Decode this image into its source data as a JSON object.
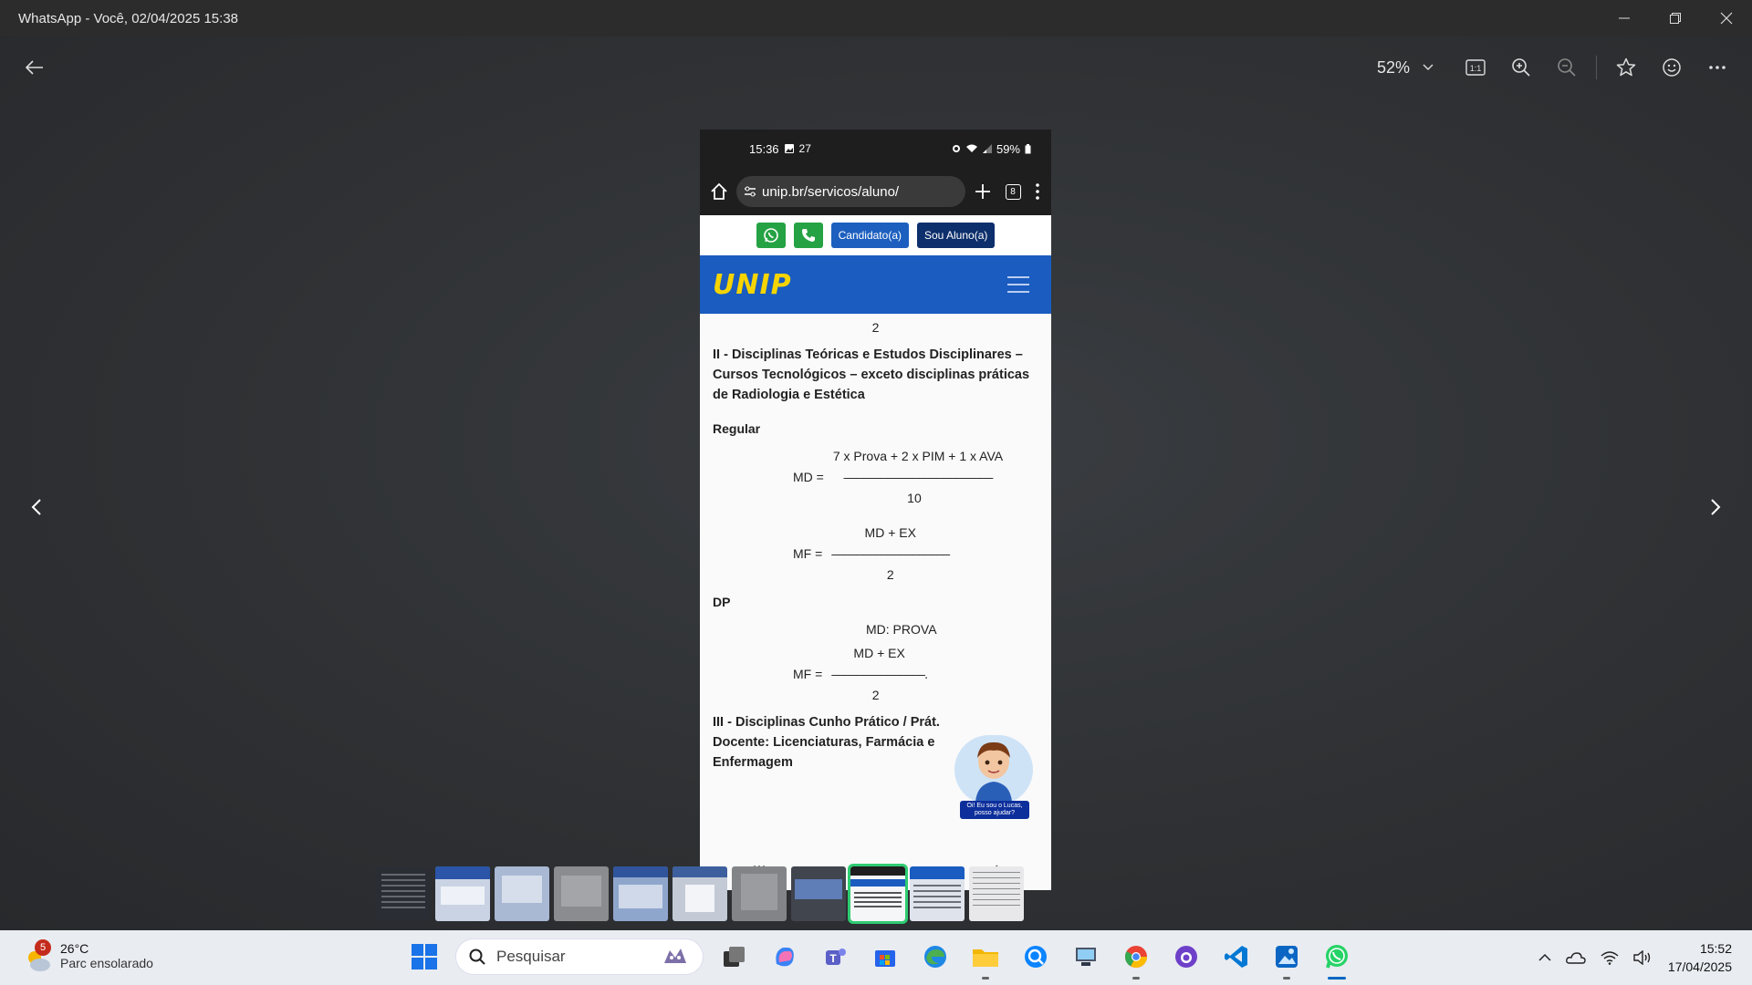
{
  "window": {
    "title": "WhatsApp - Você, 02/04/2025 15:38",
    "minimize_icon": "minimize-icon",
    "maximize_icon": "restore-icon",
    "close_icon": "close-icon"
  },
  "viewer": {
    "zoom": "52%",
    "tools": [
      "back-arrow-icon",
      "actual-size-icon",
      "zoom-in-icon",
      "zoom-out-icon",
      "favorite-star-icon",
      "emoji-icon",
      "more-icon"
    ]
  },
  "phone": {
    "status_time": "15:36",
    "status_extra": "27",
    "battery": "59%",
    "url": "unip.br/servicos/aluno/",
    "tabs_count": "8",
    "candidate_label": "Candidato(a)",
    "student_label": "Sou Aluno(a)",
    "logo_text": "UNIP",
    "content": {
      "page_num": "2",
      "section2_title": "II - Disciplinas Teóricas e Estudos Disciplinares – Cursos Tecnológicos – exceto disciplinas práticas de Radiologia e Estética",
      "regular_label": "Regular",
      "md_lhs": "MD =",
      "md_num": "7 x Prova + 2 x PIM + 1 x AVA",
      "md_line": "––––––––––––––––––––––––",
      "md_den": "10",
      "mf_lhs": "MF =",
      "mf_num": "MD + EX",
      "mf_line": "–––––––––––––––––––",
      "mf_den": "2",
      "dp_label": "DP",
      "dp_md": "MD: PROVA",
      "dp_mf_lhs": "MF =",
      "dp_mf_num": "MD + EX",
      "dp_mf_line": "–––––––––––––––.",
      "dp_mf_den": "2",
      "section3_title": "III - Disciplinas Cunho Prático / Prát. Docente: Licenciaturas, Farmácia e Enfermagem",
      "chat_bubble": "Oi! Eu sou o Lucas, posso ajudar?"
    }
  },
  "filmstrip": {
    "count": 11,
    "active_index": 8
  },
  "taskbar": {
    "weather_badge": "5",
    "temperature": "26°C",
    "weather_desc": "Parc ensolarado",
    "search_placeholder": "Pesquisar",
    "time": "15:52",
    "date": "17/04/2025"
  }
}
